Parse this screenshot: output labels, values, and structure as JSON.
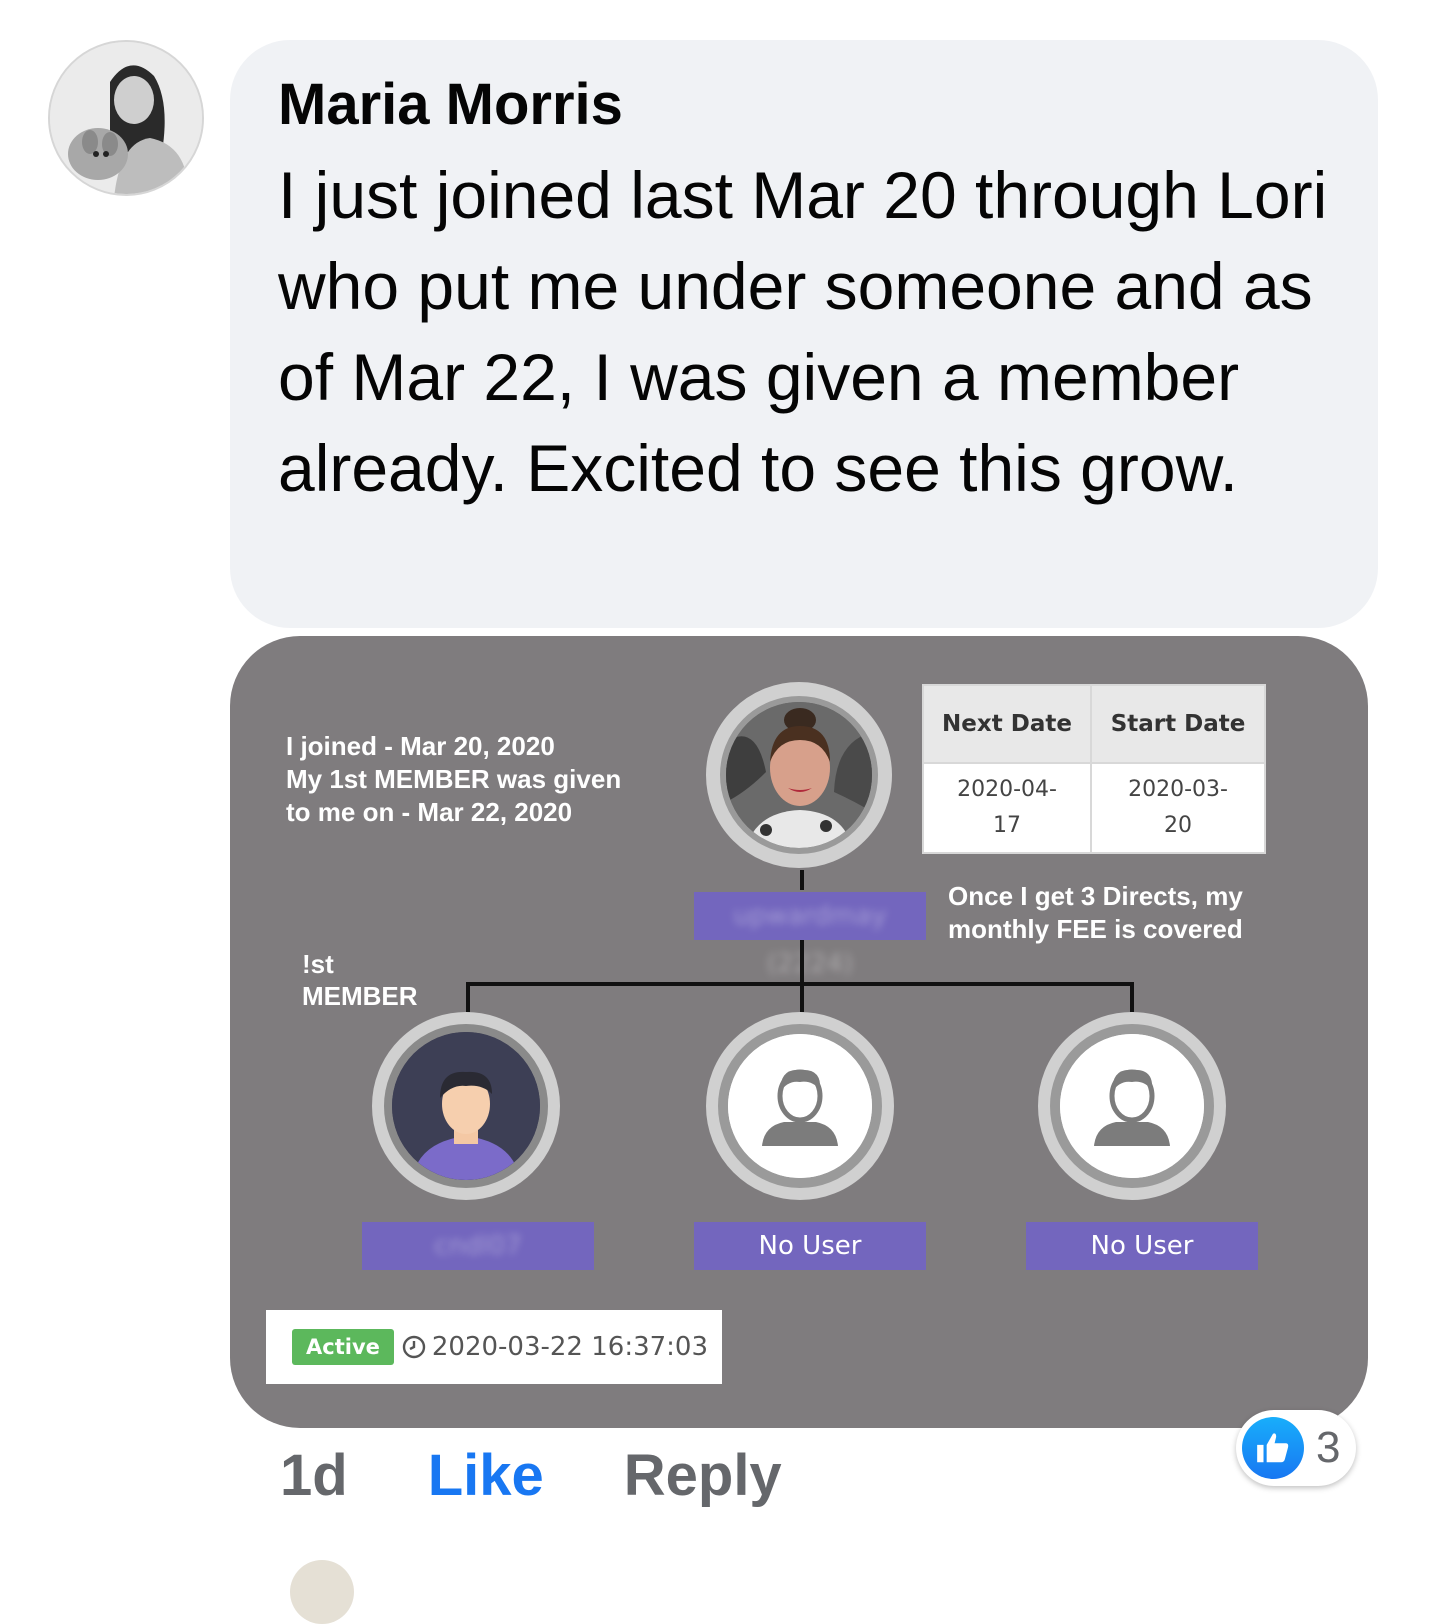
{
  "comment": {
    "author": "Maria Morris",
    "text": "I just joined last Mar 20 through Lori who put me under someone and as of Mar 22, I was given a member already. Excited to see this grow."
  },
  "attachment": {
    "note_left_lines": [
      "I joined - Mar 20, 2020",
      "My 1st MEMBER was given",
      "to me on - Mar 22, 2020"
    ],
    "note_right_lines": [
      "Once I get 3 Directs, my",
      "monthly FEE is covered"
    ],
    "member_label_lines": [
      "!st",
      "MEMBER"
    ],
    "top_user_blurred": "upwardmay (2224)",
    "table": {
      "headers": [
        "Next Date",
        "Start Date"
      ],
      "values": [
        "2020-04-17",
        "2020-03-20"
      ],
      "value_lines": [
        [
          "2020-04-",
          "17"
        ],
        [
          "2020-03-",
          "20"
        ]
      ]
    },
    "children": [
      {
        "label": "cndl07",
        "blurred": true
      },
      {
        "label": "No User",
        "blurred": false
      },
      {
        "label": "No User",
        "blurred": false
      }
    ],
    "status": {
      "badge": "Active",
      "timestamp": "2020-03-22 16:37:03",
      "badge_color": "#5cb85c"
    }
  },
  "actions": {
    "time": "1d",
    "like": "Like",
    "reply": "Reply"
  },
  "reactions": {
    "count": "3",
    "icon": "thumbs-up-icon",
    "color": "#1877f2"
  }
}
